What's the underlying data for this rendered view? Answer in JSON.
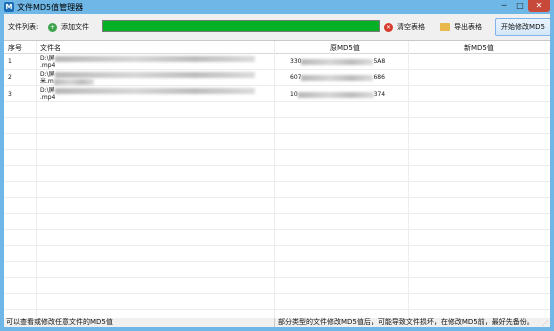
{
  "window": {
    "title": "文件MD5值管理器",
    "app_icon_glyph": "M",
    "min_glyph": "─",
    "max_glyph": "□",
    "close_glyph": "✕"
  },
  "toolbar": {
    "file_list_label": "文件列表:",
    "add_file_label": "添加文件",
    "clear_table_label": "清空表格",
    "export_table_label": "导出表格",
    "start_label": "开始修改MD5",
    "progress_fraction": 1.0,
    "progress_color": "#06b025",
    "icons": {
      "add": "plus-circle-icon",
      "clear": "x-circle-icon",
      "export": "folder-icon"
    }
  },
  "table": {
    "headers": {
      "index": "序号",
      "filename": "文件名",
      "orig_md5": "原MD5值",
      "new_md5": "新MD5值"
    },
    "rows": [
      {
        "index": "1",
        "file_line1": "D:\\屏",
        "file_line2": ".mp4",
        "orig_prefix": "330",
        "orig_suffix": "5A8",
        "new_md5": ""
      },
      {
        "index": "2",
        "file_line1": "D:\\屏",
        "file_line2": "米.m",
        "orig_prefix": "607",
        "orig_suffix": "686",
        "new_md5": ""
      },
      {
        "index": "3",
        "file_line1": "D:\\屏",
        "file_line2": ".mp4",
        "orig_prefix": "10",
        "orig_suffix": "374",
        "new_md5": ""
      }
    ]
  },
  "status": {
    "left": "可以查看或修改任意文件的MD5值",
    "right": "部分类型的文件修改MD5值后，可能导致文件损坏，在修改MD5前，最好先备份。"
  }
}
